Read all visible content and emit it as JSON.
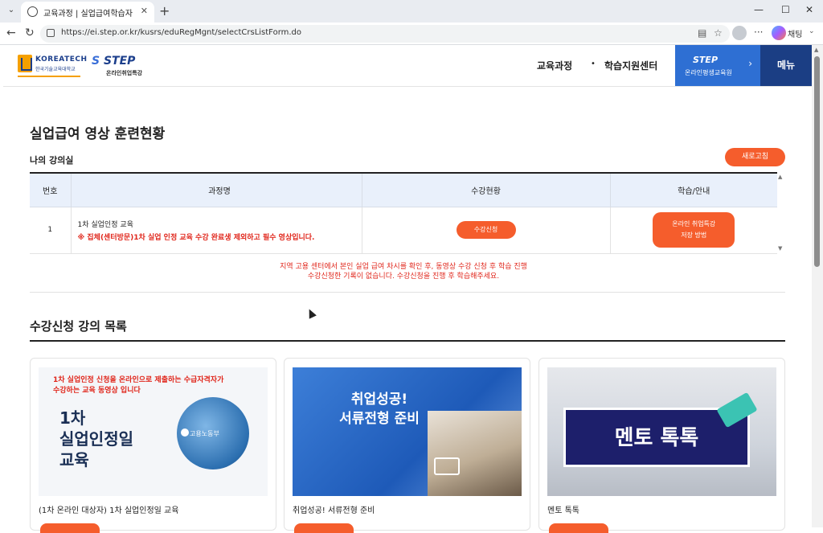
{
  "browser": {
    "tab_title": "교육과정 | 실업급여학습자",
    "url": "https://ei.step.or.kr/kusrs/eduRegMgnt/selectCrsListForm.do",
    "chat_label": "채팅",
    "icons": [
      "tab-menu-icon",
      "globe-icon",
      "close-icon",
      "plus-icon",
      "minimize-icon",
      "maximize-icon",
      "close-window-icon",
      "back-icon",
      "reload-icon",
      "lock-icon",
      "reader-icon",
      "star-icon",
      "profile-icon",
      "more-icon",
      "copilot-icon"
    ]
  },
  "header": {
    "koreatech_name": "KOREATECH",
    "koreatech_sub": "한국기술교육대학교",
    "step_brand": "STEP",
    "step_sub": "온라인취업특강",
    "nav": [
      "교육과정",
      "학습지원센터"
    ],
    "banner_title": "STEP",
    "banner_sub": "온라인평생교육원",
    "menu_label": "메뉴",
    "colors": {
      "brand_blue": "#2e6fd3",
      "navy": "#1b3e84",
      "accent": "#f55d2c"
    }
  },
  "main": {
    "page_title": "실업급여 영상 훈련현황",
    "section_title": "나의 강의실",
    "refresh_label": "새로고침",
    "table": {
      "headers": [
        "번호",
        "과정명",
        "수강현황",
        "학습/안내"
      ],
      "rows": [
        {
          "no": "1",
          "name": "1차 실업인정 교육",
          "note": "※ 집체(센터방문)1차 실업 인정 교육 수강 완료생 제외하고 필수 영상입니다.",
          "status_button": "수강신청",
          "guide_line1": "온라인 취업특강",
          "guide_line2": "저장 방법"
        }
      ]
    },
    "notice_line1": "지역 고용 센터에서 본인 실업 급여 차시를 확인 후, 동영상 수강 신청 후 학습 진행",
    "notice_line2": "수강신청한 기록이 없습니다. 수강신청을 진행 후 학습해주세요.",
    "list_title": "수강신청 강의 목록",
    "cards": [
      {
        "thumb_notice_line1": "1차 실업인정 신청을 온라인으로 제출하는 수급자격자가",
        "thumb_notice_line2": "수강하는 교육 동영상 입니다",
        "thumb_big_line1": "1차",
        "thumb_big_line2": "실업인정일",
        "thumb_big_line3": "교육",
        "thumb_badge": "고용노동부",
        "title": "(1차 온라인 대상자) 1차 실업인정일 교육"
      },
      {
        "thumb_line1": "취업성공!",
        "thumb_line2": "서류전형 준비",
        "title": "취업성공! 서류전형 준비"
      },
      {
        "thumb_board": "멘토 톡톡",
        "title": "멘토 톡톡"
      }
    ]
  }
}
